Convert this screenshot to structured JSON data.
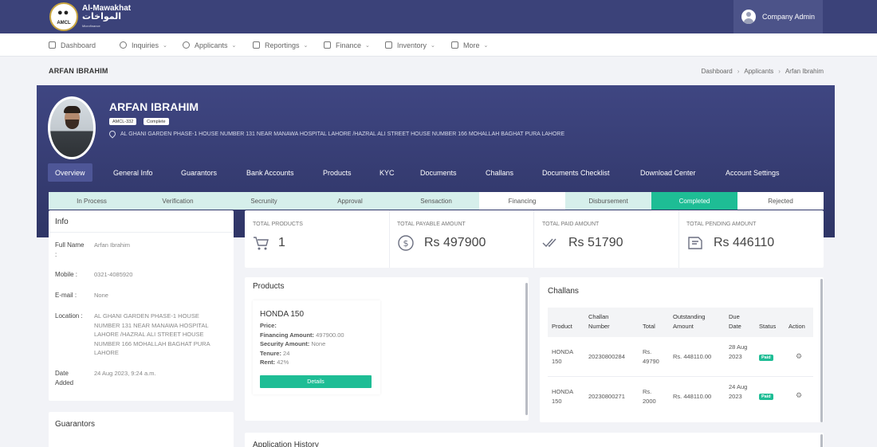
{
  "header": {
    "logo": {
      "name_en": "Al-Mawakhat",
      "name_ar": "المواخات",
      "tagline": "Microfinance",
      "abbr": "AMCL"
    },
    "user_name": "Company Admin"
  },
  "nav": [
    {
      "label": "Dashboard",
      "icon": "chart-icon",
      "has_dropdown": false
    },
    {
      "label": "Inquiries",
      "icon": "question-icon",
      "has_dropdown": true
    },
    {
      "label": "Applicants",
      "icon": "users-icon",
      "has_dropdown": true
    },
    {
      "label": "Reportings",
      "icon": "report-icon",
      "has_dropdown": true
    },
    {
      "label": "Finance",
      "icon": "finance-icon",
      "has_dropdown": true
    },
    {
      "label": "Inventory",
      "icon": "inventory-icon",
      "has_dropdown": true
    },
    {
      "label": "More",
      "icon": "briefcase-icon",
      "has_dropdown": true
    }
  ],
  "page": {
    "title": "ARFAN IBRAHIM",
    "breadcrumb": [
      "Dashboard",
      "Applicants",
      "Arfan Ibrahim"
    ]
  },
  "profile": {
    "name": "ARFAN IBRAHIM",
    "id_badge": "AMCL-332",
    "status_badge": "Complete",
    "address": "AL GHANI GARDEN PHASE-1 HOUSE NUMBER 131 NEAR MANAWA HOSPITAL LAHORE /HAZRAL ALI STREET HOUSE NUMBER 166 MOHALLAH BAGHAT PURA LAHORE",
    "tabs": [
      "Overview",
      "General Info",
      "Guarantors",
      "Bank Accounts",
      "Products",
      "KYC",
      "Documents",
      "Challans",
      "Documents Checklist",
      "Download Center",
      "Account Settings"
    ],
    "active_tab": "Overview"
  },
  "status_steps": [
    {
      "label": "In Process",
      "state": "done"
    },
    {
      "label": "Verification",
      "state": "done"
    },
    {
      "label": "Secrunity",
      "state": "done"
    },
    {
      "label": "Approval",
      "state": "done"
    },
    {
      "label": "Sensaction",
      "state": "done"
    },
    {
      "label": "Financing",
      "state": "pending"
    },
    {
      "label": "Disbursement",
      "state": "done"
    },
    {
      "label": "Completed",
      "state": "current"
    },
    {
      "label": "Rejected",
      "state": "pending"
    }
  ],
  "info": {
    "title": "Info",
    "rows": [
      {
        "label": "Full Name :",
        "value": "Arfan Ibrahim"
      },
      {
        "label": "Mobile :",
        "value": "0321-4085920"
      },
      {
        "label": "E-mail :",
        "value": "None"
      },
      {
        "label": "Location :",
        "value": "AL GHANI GARDEN PHASE-1 HOUSE NUMBER 131 NEAR MANAWA HOSPITAL LAHORE /HAZRAL ALI STREET HOUSE NUMBER 166 MOHALLAH BAGHAT PURA LAHORE"
      },
      {
        "label": "Date Added",
        "value": "24 Aug 2023, 9:24 a.m."
      }
    ]
  },
  "guarantors": {
    "title": "Guarantors"
  },
  "stats": [
    {
      "label": "TOTAL PRODUCTS",
      "value": "1",
      "icon": "cart-icon"
    },
    {
      "label": "TOTAL PAYABLE AMOUNT",
      "value": "Rs 497900",
      "icon": "dollar-cycle-icon"
    },
    {
      "label": "TOTAL PAID AMOUNT",
      "value": "Rs 51790",
      "icon": "double-check-icon"
    },
    {
      "label": "TOTAL PENDING AMOUNT",
      "value": "Rs 446110",
      "icon": "pending-money-icon"
    }
  ],
  "products": {
    "title": "Products",
    "item": {
      "name": "HONDA 150",
      "price_label": "Price:",
      "price_value": "",
      "financing_label": "Financing Amount:",
      "financing_value": "497900.00",
      "security_label": "Security Amount:",
      "security_value": "None",
      "tenure_label": "Tenure:",
      "tenure_value": "24",
      "rent_label": "Rent:",
      "rent_value": "42%",
      "details_label": "Details"
    }
  },
  "challans": {
    "title": "Challans",
    "columns": [
      "Product",
      "Challan Number",
      "Total",
      "Outstanding Amount",
      "Due Date",
      "Status",
      "Action"
    ],
    "rows": [
      {
        "product": "HONDA 150",
        "number": "20230800284",
        "total": "Rs. 49790",
        "outstanding": "Rs. 448110.00",
        "due": "28 Aug 2023",
        "status": "Paid"
      },
      {
        "product": "HONDA 150",
        "number": "20230800271",
        "total": "Rs. 2000",
        "outstanding": "Rs. 448110.00",
        "due": "24 Aug 2023",
        "status": "Paid"
      }
    ]
  },
  "history": {
    "title": "Application History"
  },
  "colors": {
    "header_bg": "#3b4279",
    "banner_bg": "#3f4682",
    "accent_green": "#1ebd95",
    "step_done_bg": "#d6efeb",
    "step_current_bg": "#1ebd95"
  }
}
